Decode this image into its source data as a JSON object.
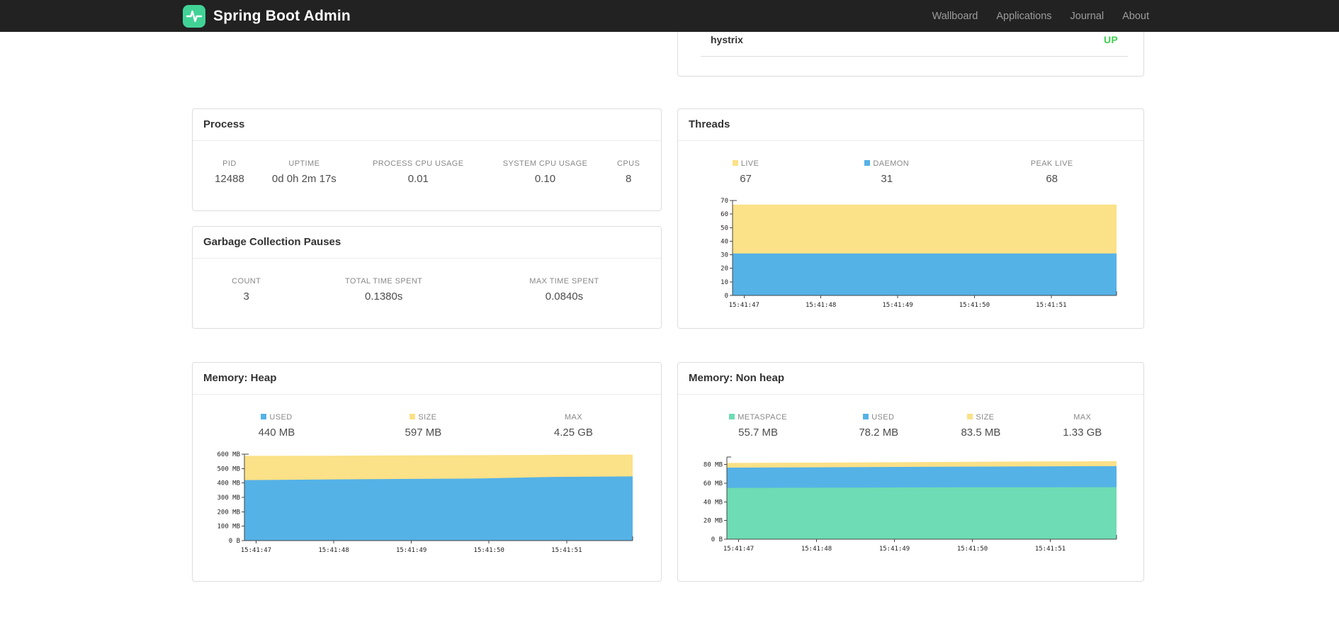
{
  "navbar": {
    "brand": "Spring Boot Admin",
    "items": [
      {
        "label": "Wallboard"
      },
      {
        "label": "Applications"
      },
      {
        "label": "Journal"
      },
      {
        "label": "About"
      }
    ]
  },
  "application_row": {
    "name": "hystrix",
    "status": "UP"
  },
  "panels": {
    "process": {
      "title": "Process",
      "stats": [
        {
          "label": "PID",
          "value": "12488"
        },
        {
          "label": "UPTIME",
          "value": "0d 0h 2m 17s"
        },
        {
          "label": "PROCESS CPU USAGE",
          "value": "0.01"
        },
        {
          "label": "SYSTEM CPU USAGE",
          "value": "0.10"
        },
        {
          "label": "CPUS",
          "value": "8"
        }
      ]
    },
    "gc": {
      "title": "Garbage Collection Pauses",
      "stats": [
        {
          "label": "COUNT",
          "value": "3"
        },
        {
          "label": "TOTAL TIME SPENT",
          "value": "0.1380s"
        },
        {
          "label": "MAX TIME SPENT",
          "value": "0.0840s"
        }
      ]
    },
    "threads": {
      "title": "Threads",
      "legend": [
        {
          "label": "LIVE",
          "value": "67",
          "swatch": "yellow"
        },
        {
          "label": "DAEMON",
          "value": "31",
          "swatch": "blue"
        },
        {
          "label": "PEAK LIVE",
          "value": "68",
          "swatch": null
        }
      ]
    },
    "heap": {
      "title": "Memory: Heap",
      "legend": [
        {
          "label": "USED",
          "value": "440 MB",
          "swatch": "blue"
        },
        {
          "label": "SIZE",
          "value": "597 MB",
          "swatch": "yellow"
        },
        {
          "label": "MAX",
          "value": "4.25 GB",
          "swatch": null
        }
      ]
    },
    "nonheap": {
      "title": "Memory: Non heap",
      "legend": [
        {
          "label": "METASPACE",
          "value": "55.7 MB",
          "swatch": "green"
        },
        {
          "label": "USED",
          "value": "78.2 MB",
          "swatch": "blue"
        },
        {
          "label": "SIZE",
          "value": "83.5 MB",
          "swatch": "yellow"
        },
        {
          "label": "MAX",
          "value": "1.33 GB",
          "swatch": null
        }
      ]
    }
  },
  "colors": {
    "yellow": "#fbe187",
    "blue": "#55b2e6",
    "green": "#6edcb4",
    "up": "#3fd04f",
    "brand_green": "#41d296"
  },
  "chart_data": [
    {
      "id": "threads",
      "type": "area",
      "title": "Threads",
      "x_labels": [
        "15:41:47",
        "15:41:48",
        "15:41:49",
        "15:41:50",
        "15:41:51"
      ],
      "y_max": 70,
      "y_ticks": [
        {
          "v": 0,
          "label": "0"
        },
        {
          "v": 10,
          "label": "10"
        },
        {
          "v": 20,
          "label": "20"
        },
        {
          "v": 30,
          "label": "30"
        },
        {
          "v": 40,
          "label": "40"
        },
        {
          "v": 50,
          "label": "50"
        },
        {
          "v": 60,
          "label": "60"
        },
        {
          "v": 70,
          "label": "70"
        }
      ],
      "layers": [
        {
          "name": "LIVE",
          "color_key": "yellow",
          "values": [
            67,
            67,
            67,
            67,
            67,
            67
          ]
        },
        {
          "name": "DAEMON",
          "color_key": "blue",
          "values": [
            31,
            31,
            31,
            31,
            31,
            31
          ]
        }
      ]
    },
    {
      "id": "heap",
      "type": "area",
      "title": "Memory: Heap",
      "x_labels": [
        "15:41:47",
        "15:41:48",
        "15:41:49",
        "15:41:50",
        "15:41:51"
      ],
      "y_max": 600,
      "y_ticks": [
        {
          "v": 0,
          "label": "0 B"
        },
        {
          "v": 100,
          "label": "100 MB"
        },
        {
          "v": 200,
          "label": "200 MB"
        },
        {
          "v": 300,
          "label": "300 MB"
        },
        {
          "v": 400,
          "label": "400 MB"
        },
        {
          "v": 500,
          "label": "500 MB"
        },
        {
          "v": 600,
          "label": "600 MB"
        }
      ],
      "layers": [
        {
          "name": "SIZE",
          "color_key": "yellow",
          "values": [
            588,
            589,
            591,
            593,
            595,
            597
          ]
        },
        {
          "name": "USED",
          "color_key": "blue",
          "values": [
            420,
            424,
            428,
            431,
            442,
            446
          ]
        }
      ]
    },
    {
      "id": "nonheap",
      "type": "area",
      "title": "Memory: Non heap",
      "x_labels": [
        "15:41:47",
        "15:41:48",
        "15:41:49",
        "15:41:50",
        "15:41:51"
      ],
      "y_max": 88,
      "y_ticks": [
        {
          "v": 0,
          "label": "0 B"
        },
        {
          "v": 20,
          "label": "20 MB"
        },
        {
          "v": 40,
          "label": "40 MB"
        },
        {
          "v": 60,
          "label": "60 MB"
        },
        {
          "v": 80,
          "label": "80 MB"
        }
      ],
      "layers": [
        {
          "name": "SIZE",
          "color_key": "yellow",
          "values": [
            81.6,
            81.9,
            82.3,
            82.8,
            83.2,
            83.5
          ]
        },
        {
          "name": "USED",
          "color_key": "blue",
          "values": [
            76.6,
            76.9,
            77.3,
            77.7,
            78.0,
            78.2
          ]
        },
        {
          "name": "METASPACE",
          "color_key": "green",
          "values": [
            54.9,
            55.1,
            55.3,
            55.5,
            55.6,
            55.7
          ]
        }
      ]
    }
  ]
}
